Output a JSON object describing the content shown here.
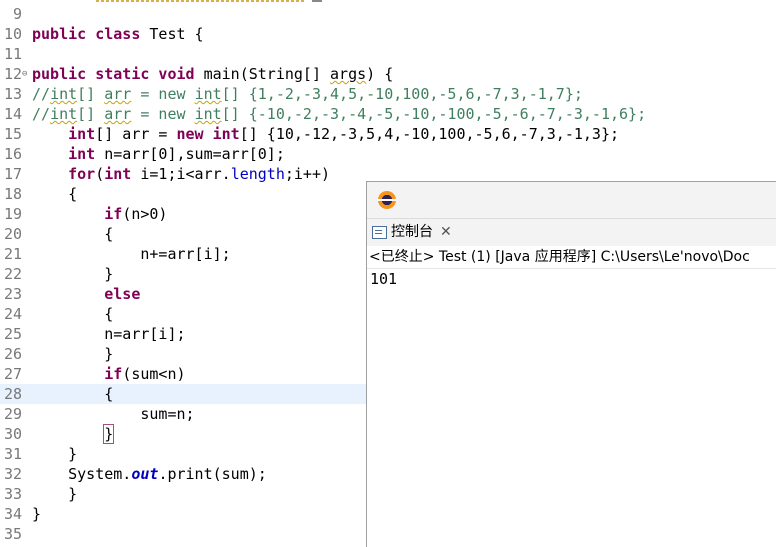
{
  "editor": {
    "lines": [
      {
        "num": "9",
        "fold": "",
        "code": []
      },
      {
        "num": "10",
        "fold": "",
        "code": [
          {
            "t": "public class",
            "c": "kw"
          },
          {
            "t": " Test {"
          }
        ]
      },
      {
        "num": "11",
        "fold": "",
        "code": []
      },
      {
        "num": "12",
        "fold": "⊖",
        "code": [
          {
            "t": "public static void",
            "c": "kw"
          },
          {
            "t": " main(String[] "
          },
          {
            "t": "args",
            "c": "squig"
          },
          {
            "t": ") {"
          }
        ]
      },
      {
        "num": "13",
        "fold": "",
        "code": [
          {
            "t": "//",
            "c": "cm"
          },
          {
            "t": "int",
            "c": "cm squig"
          },
          {
            "t": "[] ",
            "c": "cm"
          },
          {
            "t": "arr",
            "c": "cm squig"
          },
          {
            "t": " = new ",
            "c": "cm"
          },
          {
            "t": "int",
            "c": "cm squig"
          },
          {
            "t": "[] {1,-2,-3,4,5,-10,100,-5,6,-7,3,-1,7};",
            "c": "cm"
          }
        ]
      },
      {
        "num": "14",
        "fold": "",
        "code": [
          {
            "t": "//",
            "c": "cm"
          },
          {
            "t": "int",
            "c": "cm squig"
          },
          {
            "t": "[] ",
            "c": "cm"
          },
          {
            "t": "arr",
            "c": "cm squig"
          },
          {
            "t": " = new ",
            "c": "cm"
          },
          {
            "t": "int",
            "c": "cm squig"
          },
          {
            "t": "[] {-10,-2,-3,-4,-5,-10,-100,-5,-6,-7,-3,-1,6};",
            "c": "cm"
          }
        ]
      },
      {
        "num": "15",
        "fold": "",
        "code": [
          {
            "t": "    "
          },
          {
            "t": "int",
            "c": "kw"
          },
          {
            "t": "[] arr = "
          },
          {
            "t": "new",
            "c": "kw"
          },
          {
            "t": " "
          },
          {
            "t": "int",
            "c": "kw"
          },
          {
            "t": "[] {10,-12,-3,5,4,-10,100,-5,6,-7,3,-1,3};"
          }
        ]
      },
      {
        "num": "16",
        "fold": "",
        "code": [
          {
            "t": "    "
          },
          {
            "t": "int",
            "c": "kw"
          },
          {
            "t": " n=arr[0],sum=arr[0];"
          }
        ]
      },
      {
        "num": "17",
        "fold": "",
        "code": [
          {
            "t": "    "
          },
          {
            "t": "for",
            "c": "kw"
          },
          {
            "t": "("
          },
          {
            "t": "int",
            "c": "kw"
          },
          {
            "t": " i=1;i<arr."
          },
          {
            "t": "length",
            "c": "fld"
          },
          {
            "t": ";i++)"
          }
        ]
      },
      {
        "num": "18",
        "fold": "",
        "code": [
          {
            "t": "    {"
          }
        ]
      },
      {
        "num": "19",
        "fold": "",
        "code": [
          {
            "t": "        "
          },
          {
            "t": "if",
            "c": "kw"
          },
          {
            "t": "(n>0)"
          }
        ]
      },
      {
        "num": "20",
        "fold": "",
        "code": [
          {
            "t": "        {"
          }
        ]
      },
      {
        "num": "21",
        "fold": "",
        "code": [
          {
            "t": "            n+=arr[i];"
          }
        ]
      },
      {
        "num": "22",
        "fold": "",
        "code": [
          {
            "t": "        }"
          }
        ]
      },
      {
        "num": "23",
        "fold": "",
        "code": [
          {
            "t": "        "
          },
          {
            "t": "else",
            "c": "kw"
          }
        ]
      },
      {
        "num": "24",
        "fold": "",
        "code": [
          {
            "t": "        {"
          }
        ]
      },
      {
        "num": "25",
        "fold": "",
        "code": [
          {
            "t": "        n=arr[i];"
          }
        ]
      },
      {
        "num": "26",
        "fold": "",
        "code": [
          {
            "t": "        }"
          }
        ]
      },
      {
        "num": "27",
        "fold": "",
        "code": [
          {
            "t": "        "
          },
          {
            "t": "if",
            "c": "kw"
          },
          {
            "t": "(sum<n)"
          }
        ]
      },
      {
        "num": "28",
        "fold": "",
        "code": [
          {
            "t": "        {"
          }
        ],
        "current": true
      },
      {
        "num": "29",
        "fold": "",
        "code": [
          {
            "t": "            sum=n;"
          }
        ]
      },
      {
        "num": "30",
        "fold": "",
        "code": [
          {
            "t": "        "
          },
          {
            "t": "}",
            "c": "brace-hl"
          }
        ]
      },
      {
        "num": "31",
        "fold": "",
        "code": [
          {
            "t": "    }"
          }
        ]
      },
      {
        "num": "32",
        "fold": "",
        "code": [
          {
            "t": "    System."
          },
          {
            "t": "out",
            "c": "sfld"
          },
          {
            "t": ".print(sum);"
          }
        ]
      },
      {
        "num": "33",
        "fold": "",
        "code": [
          {
            "t": "    }"
          }
        ]
      },
      {
        "num": "34",
        "fold": "",
        "code": [
          {
            "t": "}"
          }
        ]
      },
      {
        "num": "35",
        "fold": "",
        "code": []
      }
    ]
  },
  "console": {
    "app_icon": "eclipse-icon",
    "tab_icon": "console-icon",
    "tab_label": "控制台",
    "tab_close": "✕",
    "status": "<已终止> Test (1)  [Java 应用程序] C:\\Users\\Le'novo\\Doc",
    "output": "101"
  }
}
